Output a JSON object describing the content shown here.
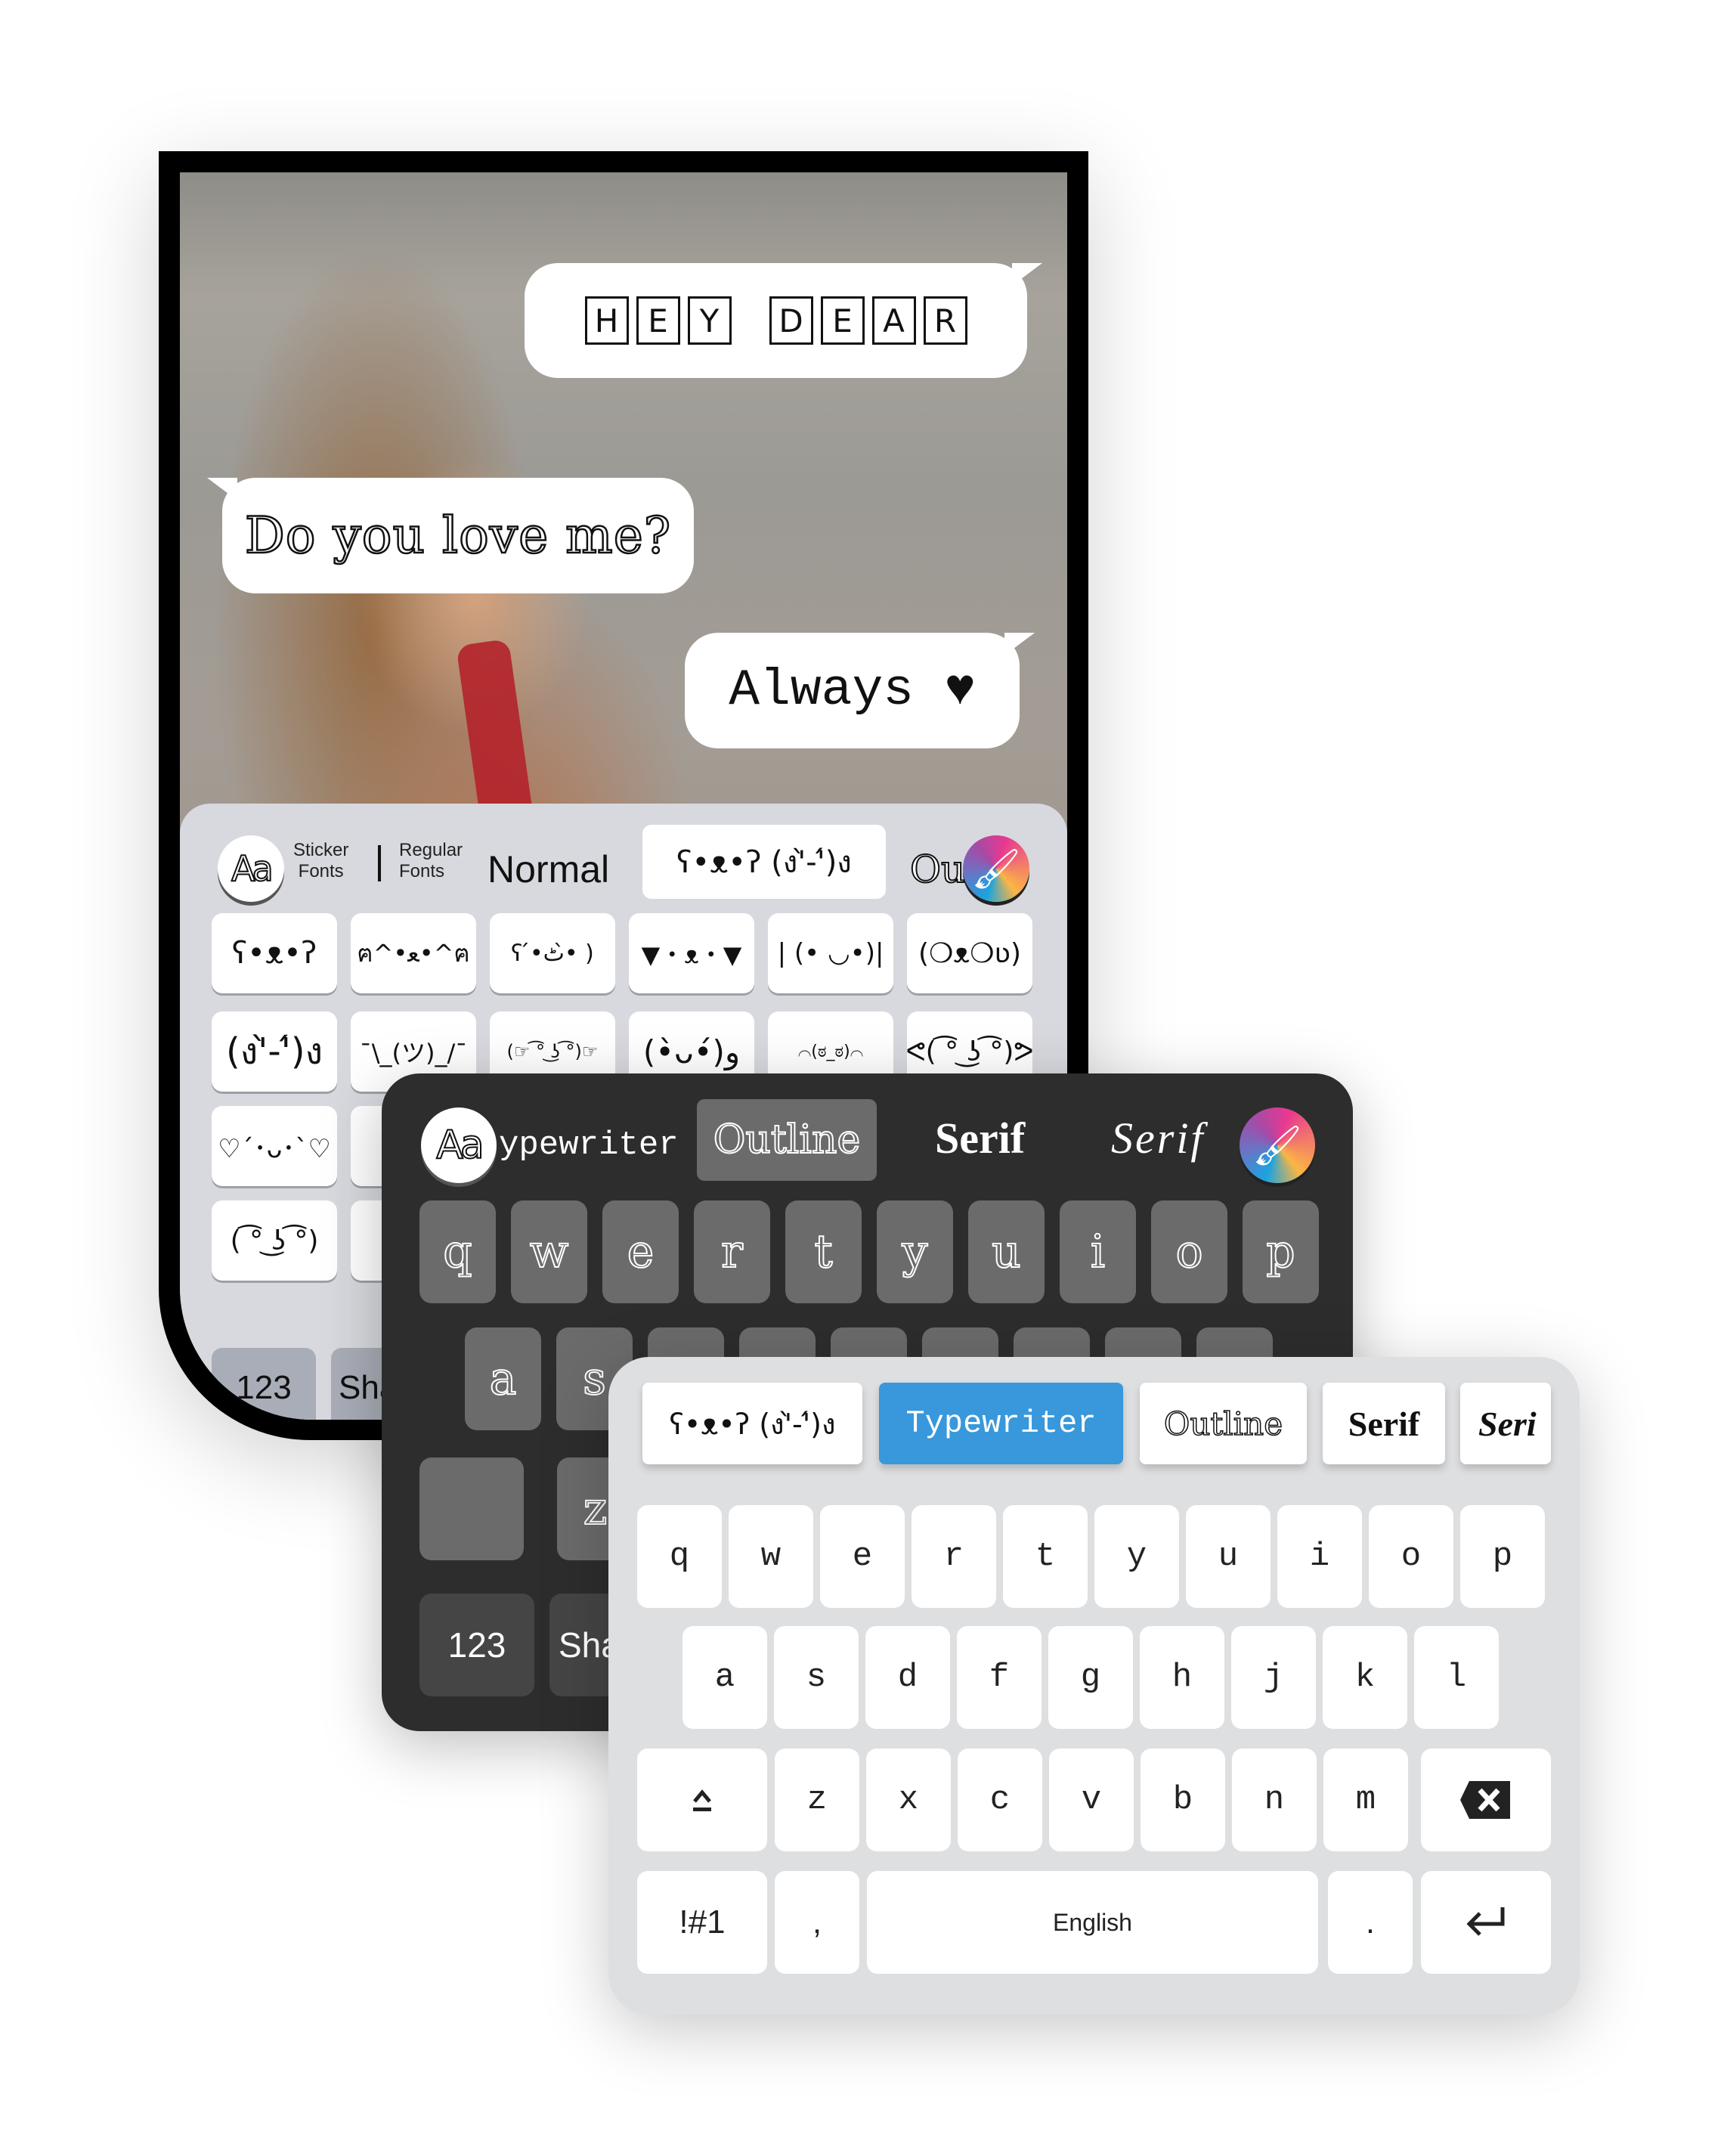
{
  "chat": {
    "messages": [
      {
        "text": "HEY DEAR",
        "letters": [
          "H",
          "E",
          "Y",
          " ",
          "D",
          "E",
          "A",
          "R"
        ],
        "style": "boxed",
        "side": "right"
      },
      {
        "text": "Do you love me?",
        "style": "outline",
        "side": "left"
      },
      {
        "text": "Always ♥",
        "style": "typewriter",
        "side": "right"
      }
    ]
  },
  "sticker_keyboard": {
    "toolbar": {
      "font_icon": "Aa",
      "sticker_fonts_label": [
        "Sticker",
        "Fonts"
      ],
      "regular_fonts_label": [
        "Regular",
        "Fonts"
      ],
      "styles": [
        "Normal",
        "ʕ•ᴥ•ʔ (ง'̀-'́)ง",
        "Ou"
      ],
      "selected_style": "ʕ•ᴥ•ʔ (ง'̀-'́)ง",
      "theme_icon": "paint-brush-icon"
    },
    "rows": [
      [
        "ʕ•ᴥ•ʔ",
        "ฅ^•ﻌ•^ฅ",
        "ʕ ́•ٹ•̀ )",
        "▼・ᴥ・▼",
        "| (• ◡•)|",
        "(❍ᴥ❍ʋ)"
      ],
      [
        "(ง'̀-'́)ง",
        "¯\\_(ツ)_/¯",
        "(☞ ͡° ͜ʖ ͡°)☞",
        "(•̀ᴗ•́)و",
        "⌒(ಠ_ಠ)⌒",
        "ᕙ( ͡° ͜ʖ ͡°)ᕗ"
      ],
      [
        "♡´･ᴗ･`♡",
        "("
      ],
      [
        "( ͡° ͜ʖ ͡°)",
        "("
      ]
    ],
    "bottom": {
      "numbers_label": "123",
      "share_label": "Sha"
    }
  },
  "dark_keyboard": {
    "toolbar": {
      "font_icon": "Aa",
      "styles": [
        "ypewriter",
        "Outline",
        "Serif",
        "Serif"
      ],
      "selected_style": "Outline",
      "theme_icon": "paint-brush-icon"
    },
    "rows": [
      [
        "q",
        "w",
        "e",
        "r",
        "t",
        "y",
        "u",
        "i",
        "o",
        "p"
      ],
      [
        "a",
        "s",
        "",
        "",
        "",
        "",
        "",
        "",
        ""
      ],
      [
        "",
        "z"
      ]
    ],
    "bottom": {
      "numbers_label": "123",
      "share_label": "Sha"
    }
  },
  "light_keyboard": {
    "tabs": [
      "ʕ•ᴥ•ʔ (ง'̀-'́)ง",
      "Typewriter",
      "Outline",
      "Serif",
      "Seri"
    ],
    "selected_tab": "Typewriter",
    "accent_color": "#3898db",
    "rows": [
      [
        "q",
        "w",
        "e",
        "r",
        "t",
        "y",
        "u",
        "i",
        "o",
        "p"
      ],
      [
        "a",
        "s",
        "d",
        "f",
        "g",
        "h",
        "j",
        "k",
        "l"
      ],
      [
        "z",
        "x",
        "c",
        "v",
        "b",
        "n",
        "m"
      ]
    ],
    "shift_icon": "shift-icon",
    "backspace_icon": "backspace-icon",
    "bottom": {
      "symbols_label": "!#1",
      "comma_label": ",",
      "space_label": "English",
      "period_label": ".",
      "enter_icon": "enter-icon"
    }
  }
}
